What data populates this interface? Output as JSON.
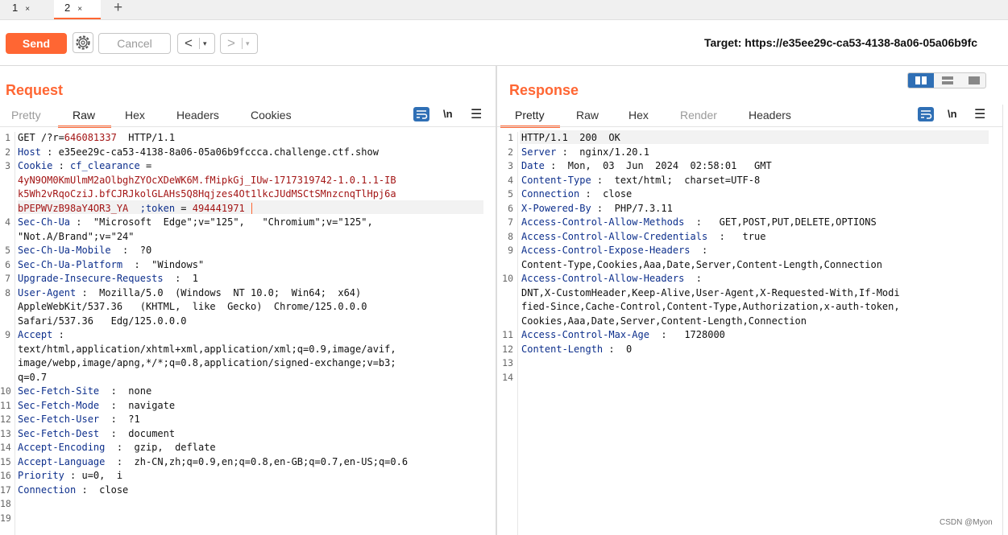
{
  "tabs": [
    {
      "label": "1"
    },
    {
      "label": "2"
    }
  ],
  "toolbar": {
    "send_label": "Send",
    "cancel_label": "Cancel",
    "back_arrow": "<",
    "forward_arrow": ">",
    "dropdown_glyph": "▾",
    "target_label": "Target: https://e35ee29c-ca53-4138-8a06-05a06b9fc",
    "close_glyph": "×",
    "add_glyph": "+"
  },
  "request": {
    "title": "Request",
    "tabs": [
      "Pretty",
      "Raw",
      "Hex",
      "Headers",
      "Cookies"
    ],
    "active_tab": "Raw",
    "newline_label": "\\n",
    "menu_glyph": "☰",
    "line_numbers": [
      "1",
      "2",
      "3",
      "",
      "",
      "",
      "4",
      "",
      "5",
      "6",
      "7",
      "8",
      "",
      "",
      "9",
      "",
      "",
      "10",
      "11",
      "12",
      "13",
      "14",
      "15",
      "16",
      "17",
      "18",
      "19"
    ],
    "request_line": {
      "method": "GET /?r=",
      "rvalue": "646081337",
      "version": "  HTTP/1.1"
    },
    "host": {
      "name": "Host",
      "value": " e35ee29c-ca53-4138-8a06-05a06b9fccca.challenge.ctf.show"
    },
    "cookie": {
      "name": "Cookie",
      "sub": "cf_clearance",
      "eq": " =",
      "v1": "4yN9OM0KmUlmM2aOlbghZYOcXDeWK6M.fMipkGj_IUw-1717319742-1.0.1.1-IB",
      "v2": "k5Wh2vRqoCziJ.bfCJRJkolGLAHs5Q8Hqjzes4Ot1lkcJUdMSCtSMnzcnqTlHpj6a",
      "v3": "bPEPWVzB98aY4OR3_YA",
      "tokname": "  ;token",
      "tokeq": " =",
      "tokval": " 494441971"
    },
    "sec_ch_ua": {
      "name": "Sec-Ch-Ua",
      "value": "  \"Microsoft  Edge\";v=\"125\",   \"Chromium\";v=\"125\",",
      "cont": "\"Not.A/Brand\";v=\"24\""
    },
    "sec_ch_ua_mobile": {
      "name": "Sec-Ch-Ua-Mobile",
      "value": "  ?0"
    },
    "sec_ch_ua_platform": {
      "name": "Sec-Ch-Ua-Platform",
      "value": "  \"Windows\""
    },
    "upgrade": {
      "name": "Upgrade-Insecure-Requests",
      "value": "  1"
    },
    "user_agent": {
      "name": "User-Agent",
      "value": "  Mozilla/5.0  (Windows  NT 10.0;  Win64;  x64)",
      "cont1": "AppleWebKit/537.36   (KHTML,  like  Gecko)  Chrome/125.0.0.0",
      "cont2": "Safari/537.36   Edg/125.0.0.0"
    },
    "accept": {
      "name": "Accept",
      "value": " :",
      "cont1": "text/html,application/xhtml+xml,application/xml;q=0.9,image/avif,",
      "cont2": "image/webp,image/apng,*/*;q=0.8,application/signed-exchange;v=b3;",
      "cont3": "q=0.7"
    },
    "sec_fetch_site": {
      "name": "Sec-Fetch-Site",
      "value": "  none"
    },
    "sec_fetch_mode": {
      "name": "Sec-Fetch-Mode",
      "value": "  navigate"
    },
    "sec_fetch_user": {
      "name": "Sec-Fetch-User",
      "value": "  ?1"
    },
    "sec_fetch_dest": {
      "name": "Sec-Fetch-Dest",
      "value": "  document"
    },
    "accept_encoding": {
      "name": "Accept-Encoding",
      "value": "  gzip,  deflate"
    },
    "accept_language": {
      "name": "Accept-Language",
      "value": "  zh-CN,zh;q=0.9,en;q=0.8,en-GB;q=0.7,en-US;q=0.6"
    },
    "priority": {
      "name": "Priority",
      "value": " u=0,  i"
    },
    "connection": {
      "name": "Connection",
      "value": "  close"
    }
  },
  "response": {
    "title": "Response",
    "tabs": [
      "Pretty",
      "Raw",
      "Hex",
      "Render",
      "Headers"
    ],
    "active_tab": "Pretty",
    "newline_label": "\\n",
    "menu_glyph": "☰",
    "line_numbers": [
      "1",
      "2",
      "3",
      "4",
      "5",
      "6",
      "7",
      "8",
      "9",
      "",
      "10",
      "",
      "",
      "11",
      "12",
      "13",
      "14"
    ],
    "status": "HTTP/1.1  200  OK",
    "server": {
      "name": "Server",
      "value": "  nginx/1.20.1"
    },
    "date": {
      "name": "Date",
      "value": "  Mon,  03  Jun  2024  02:58:01   GMT"
    },
    "content_type": {
      "name": "Content-Type",
      "value": "  text/html;  charset=UTF-8"
    },
    "connection": {
      "name": "Connection",
      "value": "  close"
    },
    "x_powered_by": {
      "name": "X-Powered-By",
      "value": "  PHP/7.3.11"
    },
    "acam": {
      "name": "Access-Control-Allow-Methods",
      "value": "   GET,POST,PUT,DELETE,OPTIONS"
    },
    "acac": {
      "name": "Access-Control-Allow-Credentials",
      "value": "   true"
    },
    "aceh": {
      "name": "Access-Control-Expose-Headers",
      "value": "  :",
      "cont": "Content-Type,Cookies,Aaa,Date,Server,Content-Length,Connection"
    },
    "acah": {
      "name": "Access-Control-Allow-Headers",
      "value": "  :",
      "cont1": "DNT,X-CustomHeader,Keep-Alive,User-Agent,X-Requested-With,If-Modi",
      "cont2": "fied-Since,Cache-Control,Content-Type,Authorization,x-auth-token,",
      "cont3": "Cookies,Aaa,Date,Server,Content-Length,Connection"
    },
    "acma": {
      "name": "Access-Control-Max-Age",
      "value": "   1728000"
    },
    "content_length": {
      "name": "Content-Length",
      "value": "  0"
    }
  },
  "watermark": "CSDN @Myon⁠"
}
